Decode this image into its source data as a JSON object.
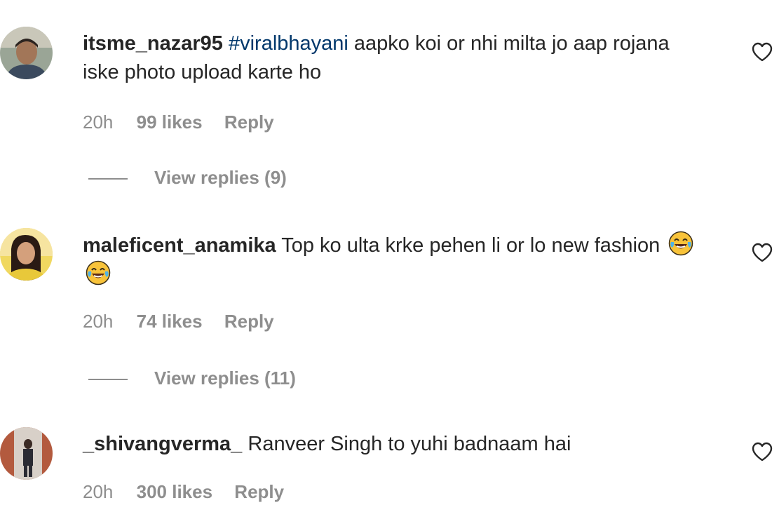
{
  "comments": [
    {
      "username": "itsme_nazar95",
      "hashtag": "#viralbhayani",
      "text": " aapko koi or nhi milta jo aap rojana iske photo upload karte ho",
      "time": "20h",
      "likes": "99 likes",
      "reply": "Reply",
      "view_replies": "View replies (9)",
      "avatar_icon": "avatar-man-icon"
    },
    {
      "username": "maleficent_anamika",
      "text": " Top ko ulta krke pehen li or lo new fashion",
      "emojis": [
        "face-with-tears-of-joy-icon",
        "face-with-tears-of-joy-icon"
      ],
      "time": "20h",
      "likes": "74 likes",
      "reply": "Reply",
      "view_replies": "View replies (11)",
      "avatar_icon": "avatar-woman-icon"
    },
    {
      "username": "_shivangverma_",
      "text": " Ranveer Singh to yuhi badnaam hai",
      "time": "20h",
      "likes": "300 likes",
      "reply": "Reply",
      "avatar_icon": "avatar-person-icon"
    }
  ],
  "icons": {
    "like": "heart-outline-icon"
  },
  "colors": {
    "text": "#262626",
    "muted": "#8e8e8e",
    "hashtag": "#00376b"
  }
}
